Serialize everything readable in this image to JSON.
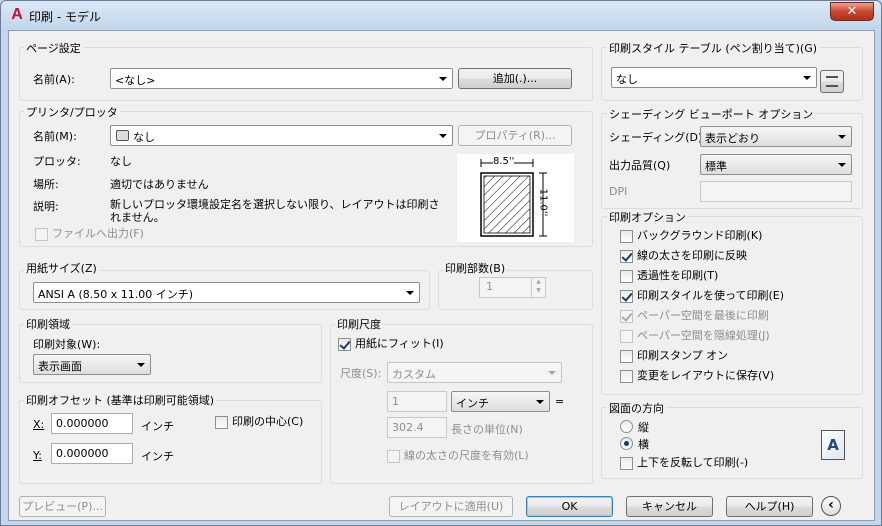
{
  "window": {
    "title": "印刷 - モデル",
    "close_icon": "close-icon",
    "app_icon": "A"
  },
  "page_setup": {
    "group_title": "ページ設定",
    "name_label": "名前(A):",
    "name_value": "<なし>",
    "add_button": "追加(.)..."
  },
  "printer": {
    "group_title": "プリンタ/プロッタ",
    "name_label": "名前(M):",
    "name_value": "なし",
    "properties_button": "プロパティ(R)...",
    "plotter_label": "プロッタ:",
    "plotter_value": "なし",
    "location_label": "場所:",
    "location_value": "適切ではありません",
    "description_label": "説明:",
    "description_value": "新しいプロッタ環境設定名を選択しない限り、レイアウトは印刷されません。",
    "print_to_file": "ファイルへ出力(F)",
    "preview_width": "8.5''",
    "preview_height": "11.0''"
  },
  "paper_size": {
    "group_title": "用紙サイズ(Z)",
    "value": "ANSI A (8.50 x 11.00 インチ)"
  },
  "copies": {
    "group_title": "印刷部数(B)",
    "value": "1"
  },
  "plot_area": {
    "group_title": "印刷領域",
    "what_label": "印刷対象(W):",
    "what_value": "表示画面"
  },
  "plot_offset": {
    "group_title": "印刷オフセット (基準は印刷可能領域)",
    "x_label": "X:",
    "x_value": "0.000000",
    "x_unit": "インチ",
    "y_label": "Y:",
    "y_value": "0.000000",
    "y_unit": "インチ",
    "center": "印刷の中心(C)"
  },
  "plot_scale": {
    "group_title": "印刷尺度",
    "fit_to_paper": "用紙にフィット(I)",
    "scale_label": "尺度(S):",
    "scale_value": "カスタム",
    "num_value": "1",
    "unit_value": "インチ",
    "equals": "=",
    "den_value": "302.4",
    "den_unit": "長さの単位(N)",
    "scale_lineweights": "線の太さの尺度を有効(L)"
  },
  "style_table": {
    "group_title": "印刷スタイル テーブル (ペン割り当て)(G)",
    "value": "なし",
    "edit_icon": "edit-style-icon"
  },
  "shaded": {
    "group_title": "シェーディング ビューポート オプション",
    "shade_label": "シェーディング(D)",
    "shade_value": "表示どおり",
    "quality_label": "出力品質(Q)",
    "quality_value": "標準",
    "dpi_label": "DPI",
    "dpi_value": ""
  },
  "plot_options": {
    "group_title": "印刷オプション",
    "items": [
      {
        "label": "バックグラウンド印刷(K)",
        "checked": false,
        "disabled": false
      },
      {
        "label": "線の太さを印刷に反映",
        "checked": true,
        "disabled": false
      },
      {
        "label": "透過性を印刷(T)",
        "checked": false,
        "disabled": false
      },
      {
        "label": "印刷スタイルを使って印刷(E)",
        "checked": true,
        "disabled": false
      },
      {
        "label": "ペーパー空間を最後に印刷",
        "checked": true,
        "disabled": true
      },
      {
        "label": "ペーパー空間を隠線処理(J)",
        "checked": false,
        "disabled": true
      },
      {
        "label": "印刷スタンプ オン",
        "checked": false,
        "disabled": false
      },
      {
        "label": "変更をレイアウトに保存(V)",
        "checked": false,
        "disabled": false
      }
    ]
  },
  "orientation": {
    "group_title": "図面の方向",
    "portrait": "縦",
    "landscape": "横",
    "upside_down": "上下を反転して印刷(-)",
    "selected": "landscape",
    "orientation_icon": "A"
  },
  "footer": {
    "preview": "プレビュー(P)...",
    "apply_layout": "レイアウトに適用(U)",
    "ok": "OK",
    "cancel": "キャンセル",
    "help": "ヘルプ(H)",
    "collapse_icon": "‹"
  }
}
